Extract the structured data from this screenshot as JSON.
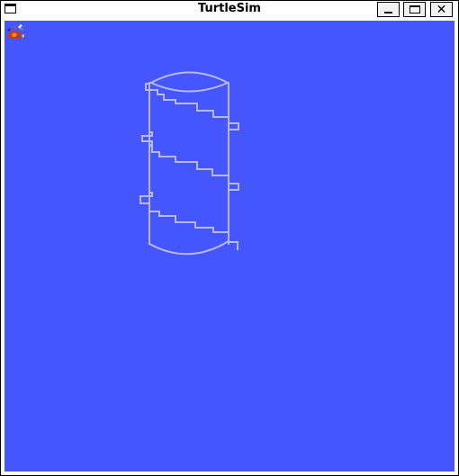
{
  "window": {
    "title": "TurtleSim",
    "controls": {
      "minimize_icon": "minimize-icon",
      "maximize_icon": "maximize-icon",
      "close_icon": "close-icon",
      "close_glyph": "✕"
    }
  },
  "canvas": {
    "background_color": "#4556ff",
    "pen_color": "#b3b8ff"
  },
  "turtle": {
    "icon": "turtle-icon"
  }
}
